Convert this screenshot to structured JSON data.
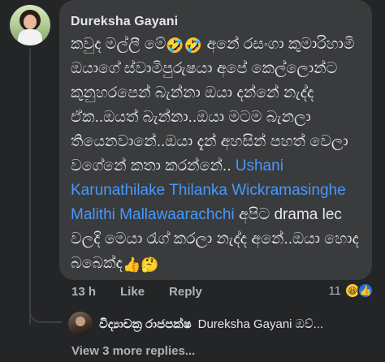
{
  "comment": {
    "author": "Dureksha Gayani",
    "text_lines": [
      "කවුද මල්ලී මේ",
      " අනේ රසංගා කුමාරිහාමි ඔයාගේ ස්වාමිපුරුෂයා අපේ කෙල්ලොන්ට කුනුහරපෙන් බැන්නා ඔයා දන්නේ නැද්ද ඒක..ඔයත් බැන්නා..ඔයා මටම බැනලා තියෙනවානේ..ඔයා දැන් අහසින් පහත් වෙලා වගේනේ කතා කරන්නේ.. "
    ],
    "emoji_after_first": [
      "🤣",
      "🤣"
    ],
    "mentions": [
      "Ushani Karunathilake",
      "Thilanka Wickramasinghe",
      "Malithi Mallawaarachchi"
    ],
    "text_after_mentions": " අපිට drama lec වලදි මෙයා රැග් කරලා නැද්ද අනේ..ඔයා හොද බබෙක්ද",
    "trailing_emoji": [
      "👍",
      "🤔"
    ]
  },
  "actions": {
    "time": "13 h",
    "like": "Like",
    "reply": "Reply"
  },
  "reactions": {
    "count": "11",
    "icons": [
      "haha-icon",
      "like-icon"
    ]
  },
  "reply": {
    "author": "විද්‍යාචක්‍ර රාජපක්ෂ",
    "preview": "Dureksha Gayani ඔව්..."
  },
  "view_more": "View 3 more replies..."
}
